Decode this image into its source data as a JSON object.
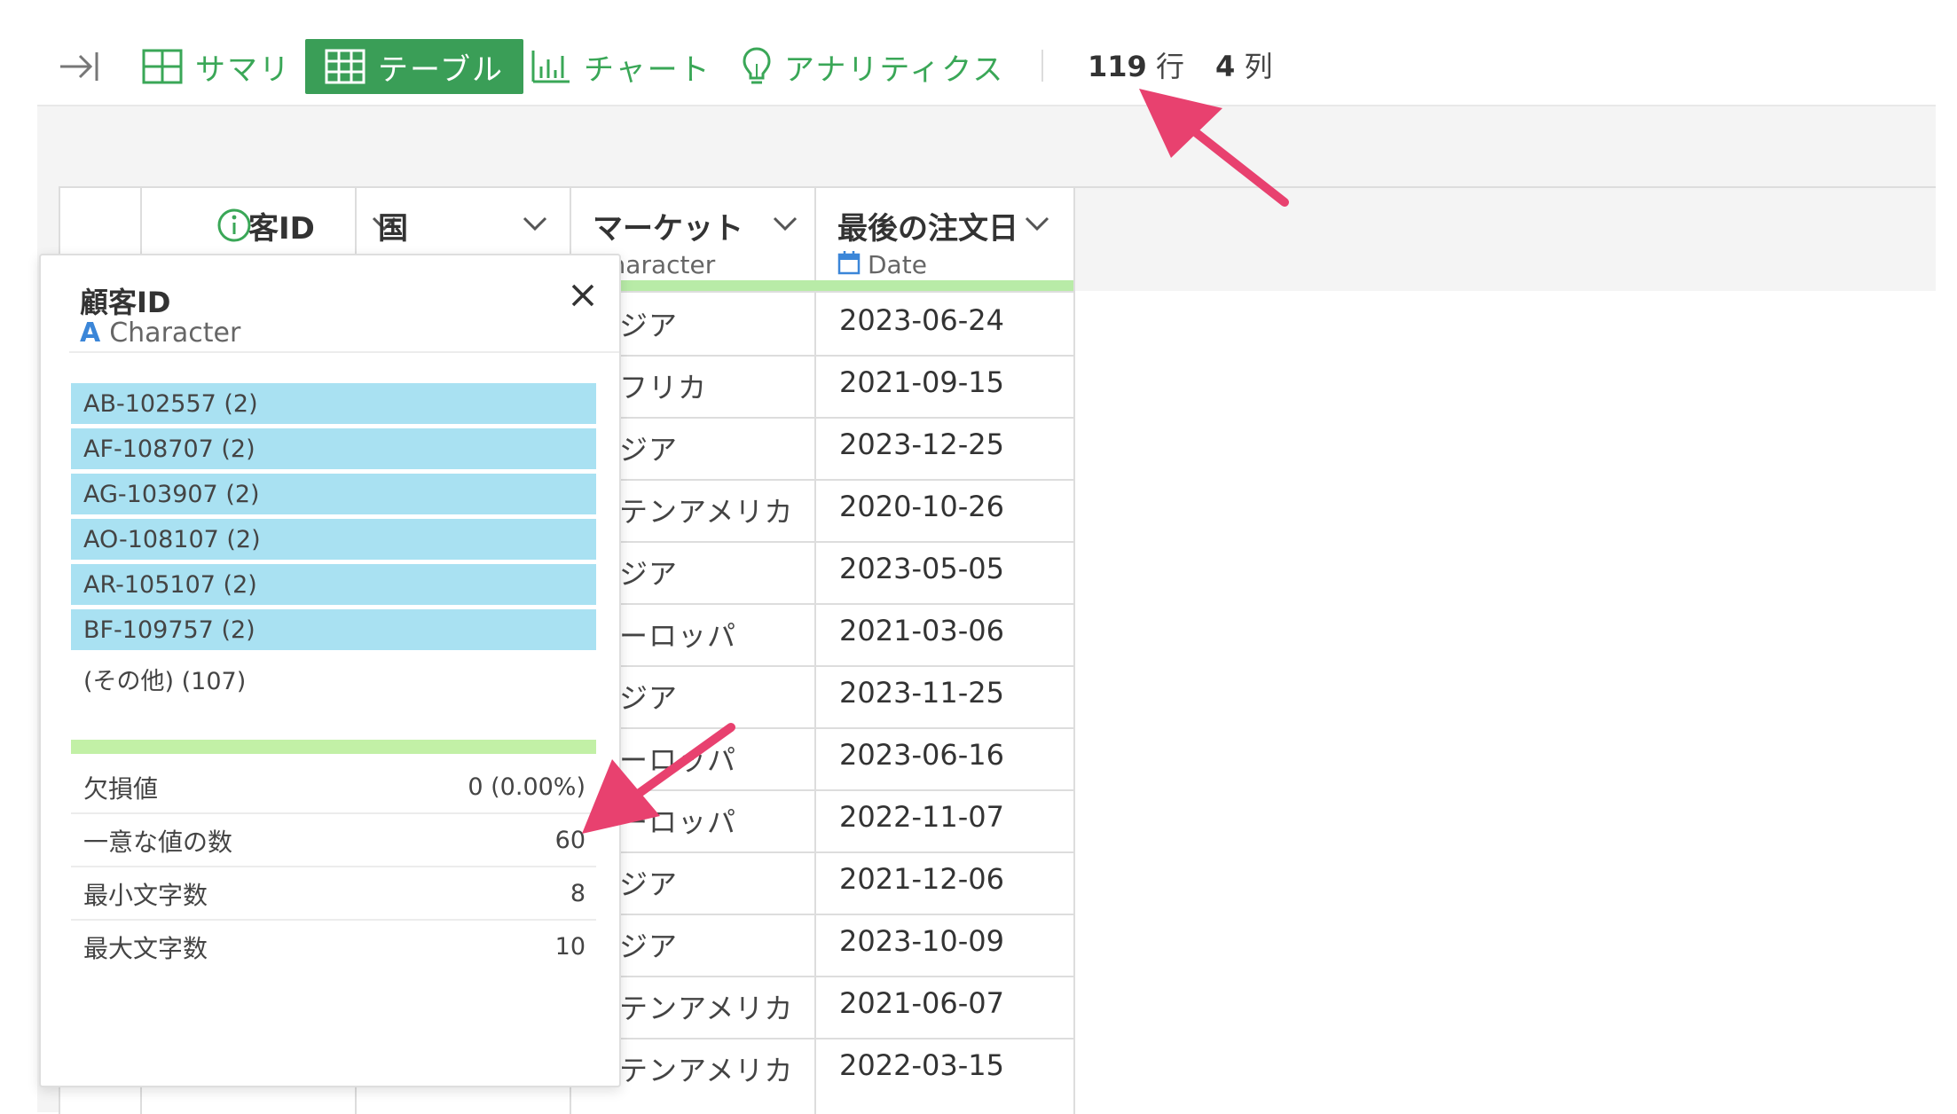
{
  "toolbar": {
    "tabs": [
      {
        "label": "サマリ",
        "icon": "grid-icon",
        "active": false
      },
      {
        "label": "テーブル",
        "icon": "table-icon",
        "active": true
      },
      {
        "label": "チャート",
        "icon": "bar-chart-icon",
        "active": false
      },
      {
        "label": "アナリティクス",
        "icon": "lightbulb-icon",
        "active": false
      }
    ],
    "rows_count": "119",
    "rows_unit": "行",
    "cols_count": "4",
    "cols_unit": "列"
  },
  "table": {
    "columns": [
      {
        "title": "客ID",
        "type": ""
      },
      {
        "title": "国",
        "type": ""
      },
      {
        "title": "マーケット",
        "type": "Character"
      },
      {
        "title": "最後の注文日",
        "type": "Date"
      }
    ],
    "rows": [
      {
        "market": "ジア",
        "date": "2023-06-24"
      },
      {
        "market": "フリカ",
        "date": "2021-09-15"
      },
      {
        "market": "ジア",
        "date": "2023-12-25"
      },
      {
        "market": "テンアメリカ",
        "date": "2020-10-26"
      },
      {
        "market": "ジア",
        "date": "2023-05-05"
      },
      {
        "market": "ーロッパ",
        "date": "2021-03-06"
      },
      {
        "market": "ジア",
        "date": "2023-11-25"
      },
      {
        "market": "ーロッパ",
        "date": "2023-06-16"
      },
      {
        "market": "ーロッパ",
        "date": "2022-11-07"
      },
      {
        "market": "ジア",
        "date": "2021-12-06"
      },
      {
        "market": "ジア",
        "date": "2023-10-09"
      },
      {
        "market": "テンアメリカ",
        "date": "2021-06-07"
      },
      {
        "market": "テンアメリカ",
        "date": "2022-03-15"
      }
    ]
  },
  "popup": {
    "title": "顧客ID",
    "type_badge": "A",
    "type": "Character",
    "top_values": [
      "AB-102557 (2)",
      "AF-108707 (2)",
      "AG-103907 (2)",
      "AO-108107 (2)",
      "AR-105107 (2)",
      "BF-109757 (2)"
    ],
    "other": "(その他) (107)",
    "stats": [
      {
        "label": "欠損値",
        "value": "0 (0.00%)"
      },
      {
        "label": "一意な値の数",
        "value": "60"
      },
      {
        "label": "最小文字数",
        "value": "8"
      },
      {
        "label": "最大文字数",
        "value": "10"
      }
    ]
  },
  "colors": {
    "accent_green": "#3a9e57",
    "highlight_blue": "#a9e1f2",
    "bar_green": "#c2f0a6",
    "annotation_arrow": "#e8416f"
  }
}
